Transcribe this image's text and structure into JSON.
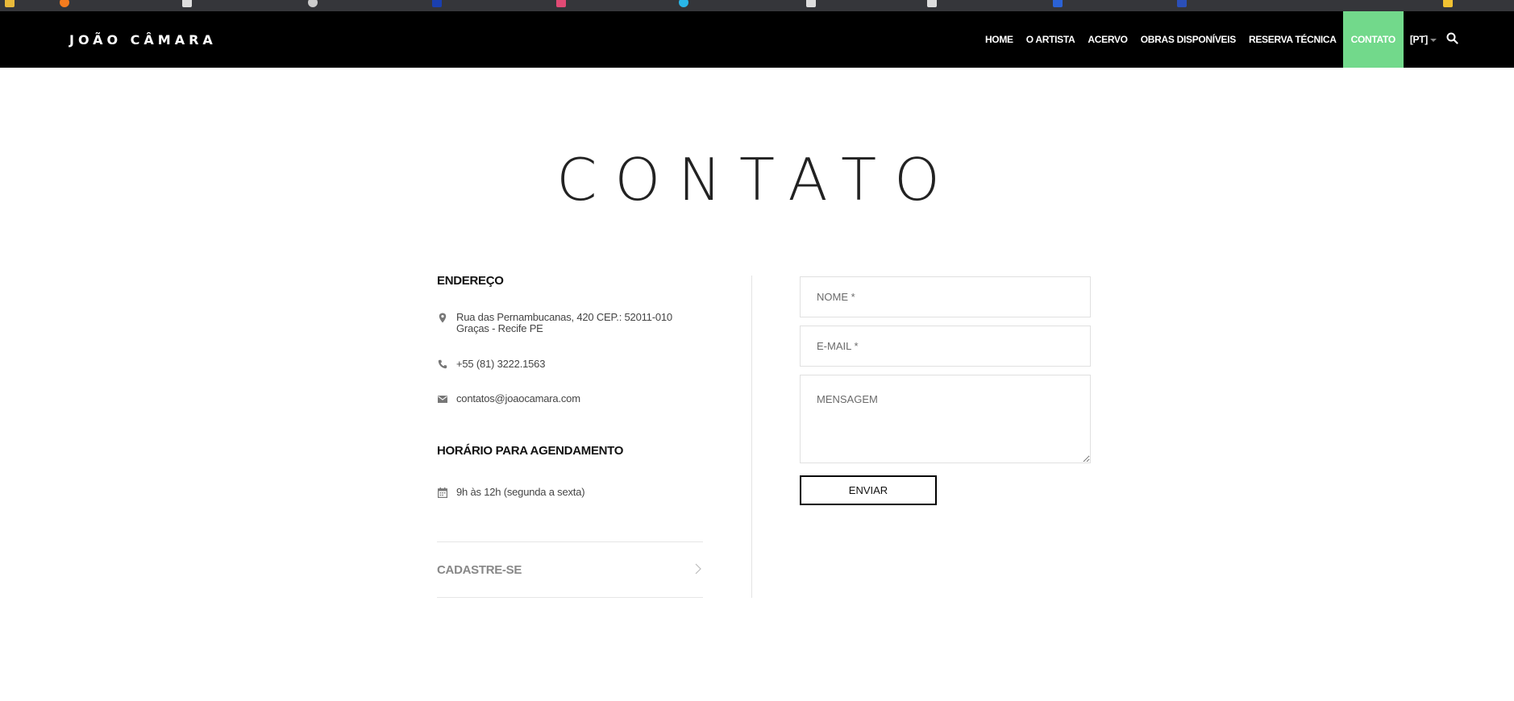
{
  "colors": {
    "header_bg": "#000000",
    "active_nav_bg": "#72d98b",
    "text_dark": "#222222",
    "muted": "#888888",
    "border": "#e0e0e0"
  },
  "site": {
    "logo": "JOÃO CÂMARA"
  },
  "nav": {
    "items": [
      {
        "label": "HOME"
      },
      {
        "label": "O ARTISTA"
      },
      {
        "label": "ACERVO"
      },
      {
        "label": "OBRAS DISPONÍVEIS"
      },
      {
        "label": "RESERVA TÉCNICA"
      },
      {
        "label": "CONTATO",
        "active": true
      }
    ],
    "language": "[PT]",
    "search_icon": "search-icon"
  },
  "page": {
    "title": "CONTATO"
  },
  "contact": {
    "address_heading": "ENDEREÇO",
    "address_line1": "Rua das Pernambucanas, 420 CEP.: 52011-010",
    "address_line2": "Graças - Recife PE",
    "phone": "+55 (81) 3222.1563",
    "email": "contatos@joaocamara.com",
    "schedule_heading": "HORÁRIO PARA AGENDAMENTO",
    "schedule": "9h às 12h (segunda a sexta)",
    "signup_label": "CADASTRE-SE"
  },
  "form": {
    "name_placeholder": "NOME *",
    "email_placeholder": "E-MAIL *",
    "message_placeholder": "MENSAGEM",
    "submit_label": "ENVIAR"
  }
}
